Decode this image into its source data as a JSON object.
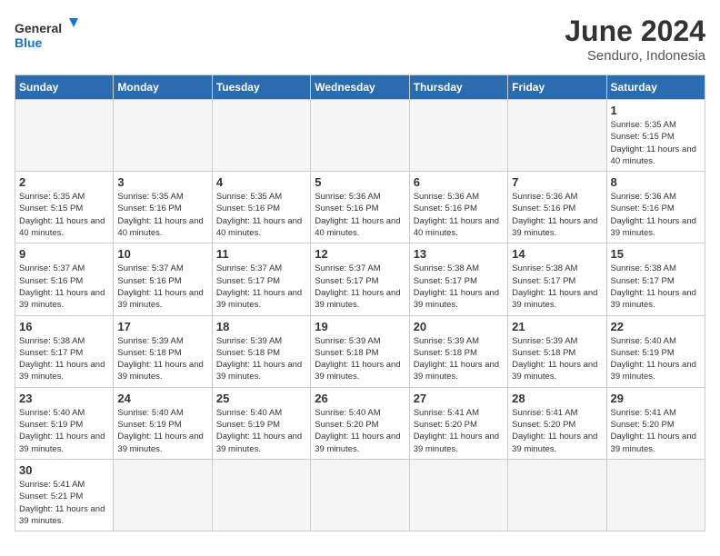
{
  "header": {
    "logo_general": "General",
    "logo_blue": "Blue",
    "month_title": "June 2024",
    "subtitle": "Senduro, Indonesia"
  },
  "weekdays": [
    "Sunday",
    "Monday",
    "Tuesday",
    "Wednesday",
    "Thursday",
    "Friday",
    "Saturday"
  ],
  "weeks": [
    [
      {
        "day": "",
        "empty": true
      },
      {
        "day": "",
        "empty": true
      },
      {
        "day": "",
        "empty": true
      },
      {
        "day": "",
        "empty": true
      },
      {
        "day": "",
        "empty": true
      },
      {
        "day": "",
        "empty": true
      },
      {
        "day": "1",
        "sunrise": "5:35 AM",
        "sunset": "5:15 PM",
        "daylight": "11 hours and 40 minutes."
      }
    ],
    [
      {
        "day": "2",
        "sunrise": "5:35 AM",
        "sunset": "5:15 PM",
        "daylight": "11 hours and 40 minutes."
      },
      {
        "day": "3",
        "sunrise": "5:35 AM",
        "sunset": "5:16 PM",
        "daylight": "11 hours and 40 minutes."
      },
      {
        "day": "4",
        "sunrise": "5:35 AM",
        "sunset": "5:16 PM",
        "daylight": "11 hours and 40 minutes."
      },
      {
        "day": "5",
        "sunrise": "5:36 AM",
        "sunset": "5:16 PM",
        "daylight": "11 hours and 40 minutes."
      },
      {
        "day": "6",
        "sunrise": "5:36 AM",
        "sunset": "5:16 PM",
        "daylight": "11 hours and 40 minutes."
      },
      {
        "day": "7",
        "sunrise": "5:36 AM",
        "sunset": "5:16 PM",
        "daylight": "11 hours and 39 minutes."
      },
      {
        "day": "8",
        "sunrise": "5:36 AM",
        "sunset": "5:16 PM",
        "daylight": "11 hours and 39 minutes."
      }
    ],
    [
      {
        "day": "9",
        "sunrise": "5:37 AM",
        "sunset": "5:16 PM",
        "daylight": "11 hours and 39 minutes."
      },
      {
        "day": "10",
        "sunrise": "5:37 AM",
        "sunset": "5:16 PM",
        "daylight": "11 hours and 39 minutes."
      },
      {
        "day": "11",
        "sunrise": "5:37 AM",
        "sunset": "5:17 PM",
        "daylight": "11 hours and 39 minutes."
      },
      {
        "day": "12",
        "sunrise": "5:37 AM",
        "sunset": "5:17 PM",
        "daylight": "11 hours and 39 minutes."
      },
      {
        "day": "13",
        "sunrise": "5:38 AM",
        "sunset": "5:17 PM",
        "daylight": "11 hours and 39 minutes."
      },
      {
        "day": "14",
        "sunrise": "5:38 AM",
        "sunset": "5:17 PM",
        "daylight": "11 hours and 39 minutes."
      },
      {
        "day": "15",
        "sunrise": "5:38 AM",
        "sunset": "5:17 PM",
        "daylight": "11 hours and 39 minutes."
      }
    ],
    [
      {
        "day": "16",
        "sunrise": "5:38 AM",
        "sunset": "5:17 PM",
        "daylight": "11 hours and 39 minutes."
      },
      {
        "day": "17",
        "sunrise": "5:39 AM",
        "sunset": "5:18 PM",
        "daylight": "11 hours and 39 minutes."
      },
      {
        "day": "18",
        "sunrise": "5:39 AM",
        "sunset": "5:18 PM",
        "daylight": "11 hours and 39 minutes."
      },
      {
        "day": "19",
        "sunrise": "5:39 AM",
        "sunset": "5:18 PM",
        "daylight": "11 hours and 39 minutes."
      },
      {
        "day": "20",
        "sunrise": "5:39 AM",
        "sunset": "5:18 PM",
        "daylight": "11 hours and 39 minutes."
      },
      {
        "day": "21",
        "sunrise": "5:39 AM",
        "sunset": "5:18 PM",
        "daylight": "11 hours and 39 minutes."
      },
      {
        "day": "22",
        "sunrise": "5:40 AM",
        "sunset": "5:19 PM",
        "daylight": "11 hours and 39 minutes."
      }
    ],
    [
      {
        "day": "23",
        "sunrise": "5:40 AM",
        "sunset": "5:19 PM",
        "daylight": "11 hours and 39 minutes."
      },
      {
        "day": "24",
        "sunrise": "5:40 AM",
        "sunset": "5:19 PM",
        "daylight": "11 hours and 39 minutes."
      },
      {
        "day": "25",
        "sunrise": "5:40 AM",
        "sunset": "5:19 PM",
        "daylight": "11 hours and 39 minutes."
      },
      {
        "day": "26",
        "sunrise": "5:40 AM",
        "sunset": "5:20 PM",
        "daylight": "11 hours and 39 minutes."
      },
      {
        "day": "27",
        "sunrise": "5:41 AM",
        "sunset": "5:20 PM",
        "daylight": "11 hours and 39 minutes."
      },
      {
        "day": "28",
        "sunrise": "5:41 AM",
        "sunset": "5:20 PM",
        "daylight": "11 hours and 39 minutes."
      },
      {
        "day": "29",
        "sunrise": "5:41 AM",
        "sunset": "5:20 PM",
        "daylight": "11 hours and 39 minutes."
      }
    ],
    [
      {
        "day": "30",
        "sunrise": "5:41 AM",
        "sunset": "5:21 PM",
        "daylight": "11 hours and 39 minutes."
      },
      {
        "day": "",
        "empty": true
      },
      {
        "day": "",
        "empty": true
      },
      {
        "day": "",
        "empty": true
      },
      {
        "day": "",
        "empty": true
      },
      {
        "day": "",
        "empty": true
      },
      {
        "day": "",
        "empty": true
      }
    ]
  ]
}
